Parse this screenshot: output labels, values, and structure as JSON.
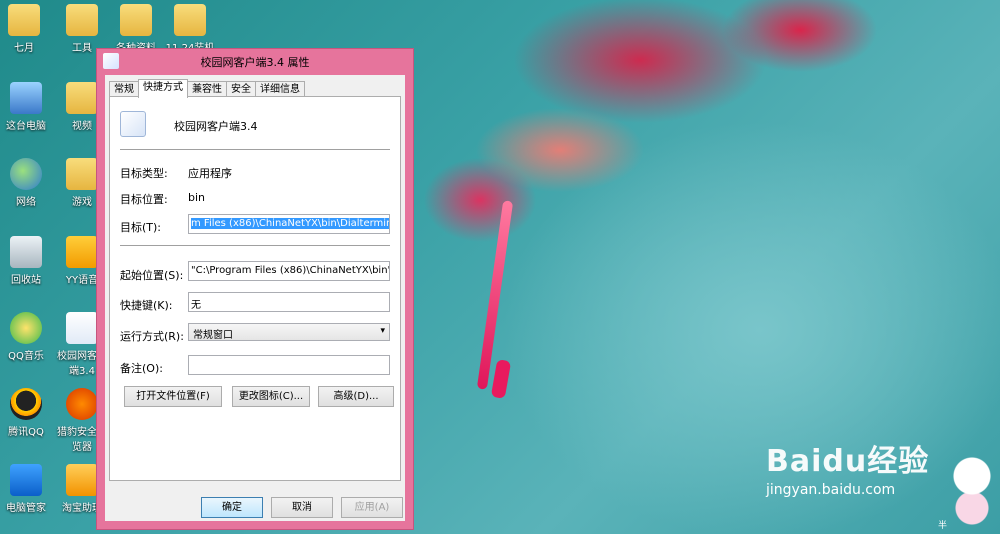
{
  "desktop": {
    "icons": [
      {
        "label": "七月",
        "icon": "folder-icon"
      },
      {
        "label": "工具",
        "icon": "folder-icon"
      },
      {
        "label": "各种资料",
        "icon": "folder-icon"
      },
      {
        "label": "11.24装机",
        "icon": "folder-icon"
      },
      {
        "label": "这台电脑",
        "icon": "computer-icon"
      },
      {
        "label": "视频",
        "icon": "folder-icon"
      },
      {
        "label": "网络",
        "icon": "network-icon"
      },
      {
        "label": "游戏",
        "icon": "folder-icon"
      },
      {
        "label": "回收站",
        "icon": "recycle-bin-icon"
      },
      {
        "label": "YY语音",
        "icon": "yy-icon"
      },
      {
        "label": "QQ音乐",
        "icon": "qqmusic-icon"
      },
      {
        "label": "校园网客户端3.4",
        "icon": "chinanetyx-icon"
      },
      {
        "label": "腾讯QQ",
        "icon": "qq-icon"
      },
      {
        "label": "猎豹安全浏览器",
        "icon": "leopard-browser-icon"
      },
      {
        "label": "电脑管家",
        "icon": "pc-manager-icon"
      },
      {
        "label": "淘宝助理",
        "icon": "taobao-icon"
      }
    ]
  },
  "dialog": {
    "title": "校园网客户端3.4 属性",
    "tabs": [
      "常规",
      "快捷方式",
      "兼容性",
      "安全",
      "详细信息"
    ],
    "active_tab": "快捷方式",
    "app_name": "校园网客户端3.4",
    "fields": {
      "target_type_label": "目标类型:",
      "target_type_value": "应用程序",
      "target_location_label": "目标位置:",
      "target_location_value": "bin",
      "target_label": "目标(T):",
      "target_value": "m Files (x86)\\ChinaNetYX\\bin\\Dialterminal.exe\"",
      "start_in_label": "起始位置(S):",
      "start_in_value": "\"C:\\Program Files (x86)\\ChinaNetYX\\bin\"",
      "shortcut_key_label": "快捷键(K):",
      "shortcut_key_value": "无",
      "run_label": "运行方式(R):",
      "run_value": "常规窗口",
      "comment_label": "备注(O):",
      "comment_value": ""
    },
    "buttons": {
      "open_location": "打开文件位置(F)",
      "change_icon": "更改图标(C)...",
      "advanced": "高级(D)...",
      "ok": "确定",
      "cancel": "取消",
      "apply": "应用(A)"
    }
  },
  "watermark": {
    "logo": "Baidu经验",
    "url": "jingyan.baidu.com",
    "mascot_text": "半"
  }
}
